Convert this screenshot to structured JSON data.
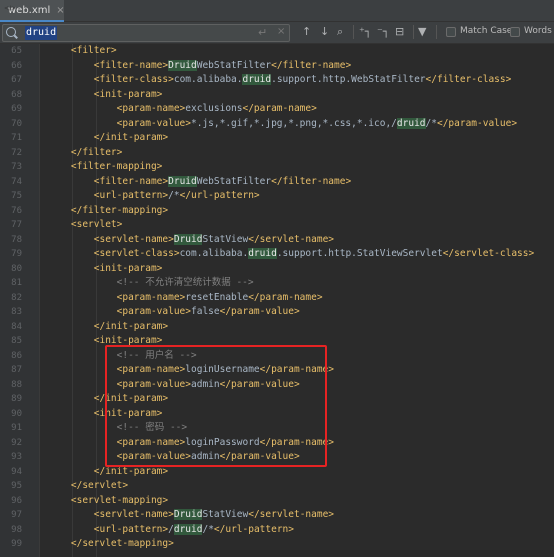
{
  "tab": {
    "label": "web.xml",
    "close": "×"
  },
  "find": {
    "query": "druid",
    "enter": "↵",
    "clear": "×",
    "match_case": "Match Case",
    "words": "Words"
  },
  "lines": [
    {
      "n": "65",
      "text": "    <filter>",
      "kind": "tag"
    },
    {
      "n": "66",
      "text": "        <filter-name>DruidWebStatFilter</filter-name>",
      "kind": "tag"
    },
    {
      "n": "67",
      "text": "        <filter-class>com.alibaba.druid.support.http.WebStatFilter</filter-class>",
      "kind": "tag"
    },
    {
      "n": "68",
      "text": "        <init-param>",
      "kind": "tag"
    },
    {
      "n": "69",
      "text": "            <param-name>exclusions</param-name>",
      "kind": "tag"
    },
    {
      "n": "70",
      "text": "            <param-value>*.js,*.gif,*.jpg,*.png,*.css,*.ico,/druid/*</param-value>",
      "kind": "tag"
    },
    {
      "n": "71",
      "text": "        </init-param>",
      "kind": "tag"
    },
    {
      "n": "72",
      "text": "    </filter>",
      "kind": "tag"
    },
    {
      "n": "73",
      "text": "    <filter-mapping>",
      "kind": "tag"
    },
    {
      "n": "74",
      "text": "        <filter-name>DruidWebStatFilter</filter-name>",
      "kind": "tag"
    },
    {
      "n": "75",
      "text": "        <url-pattern>/*</url-pattern>",
      "kind": "tag"
    },
    {
      "n": "76",
      "text": "    </filter-mapping>",
      "kind": "tag"
    },
    {
      "n": "77",
      "text": "    <servlet>",
      "kind": "tag"
    },
    {
      "n": "78",
      "text": "        <servlet-name>DruidStatView</servlet-name>",
      "kind": "tag"
    },
    {
      "n": "79",
      "text": "        <servlet-class>com.alibaba.druid.support.http.StatViewServlet</servlet-class>",
      "kind": "tag"
    },
    {
      "n": "80",
      "text": "        <init-param>",
      "kind": "tag"
    },
    {
      "n": "81",
      "text": "            <!-- 不允许清空统计数据 -->",
      "kind": "cmt"
    },
    {
      "n": "82",
      "text": "            <param-name>resetEnable</param-name>",
      "kind": "tag"
    },
    {
      "n": "83",
      "text": "            <param-value>false</param-value>",
      "kind": "tag"
    },
    {
      "n": "84",
      "text": "        </init-param>",
      "kind": "tag"
    },
    {
      "n": "85",
      "text": "        <init-param>",
      "kind": "tag"
    },
    {
      "n": "86",
      "text": "            <!-- 用户名 -->",
      "kind": "cmt"
    },
    {
      "n": "87",
      "text": "            <param-name>loginUsername</param-name>",
      "kind": "tag"
    },
    {
      "n": "88",
      "text": "            <param-value>admin</param-value>",
      "kind": "tag"
    },
    {
      "n": "89",
      "text": "        </init-param>",
      "kind": "tag"
    },
    {
      "n": "90",
      "text": "        <init-param>",
      "kind": "tag"
    },
    {
      "n": "91",
      "text": "            <!-- 密码 -->",
      "kind": "cmt"
    },
    {
      "n": "92",
      "text": "            <param-name>loginPassword</param-name>",
      "kind": "tag"
    },
    {
      "n": "93",
      "text": "            <param-value>admin</param-value>",
      "kind": "tag"
    },
    {
      "n": "94",
      "text": "        </init-param>",
      "kind": "tag"
    },
    {
      "n": "95",
      "text": "    </servlet>",
      "kind": "tag"
    },
    {
      "n": "96",
      "text": "    <servlet-mapping>",
      "kind": "tag"
    },
    {
      "n": "97",
      "text": "        <servlet-name>DruidStatView</servlet-name>",
      "kind": "tag"
    },
    {
      "n": "98",
      "text": "        <url-pattern>/druid/*</url-pattern>",
      "kind": "tag"
    },
    {
      "n": "99",
      "text": "    </servlet-mapping>",
      "kind": "tag"
    }
  ]
}
